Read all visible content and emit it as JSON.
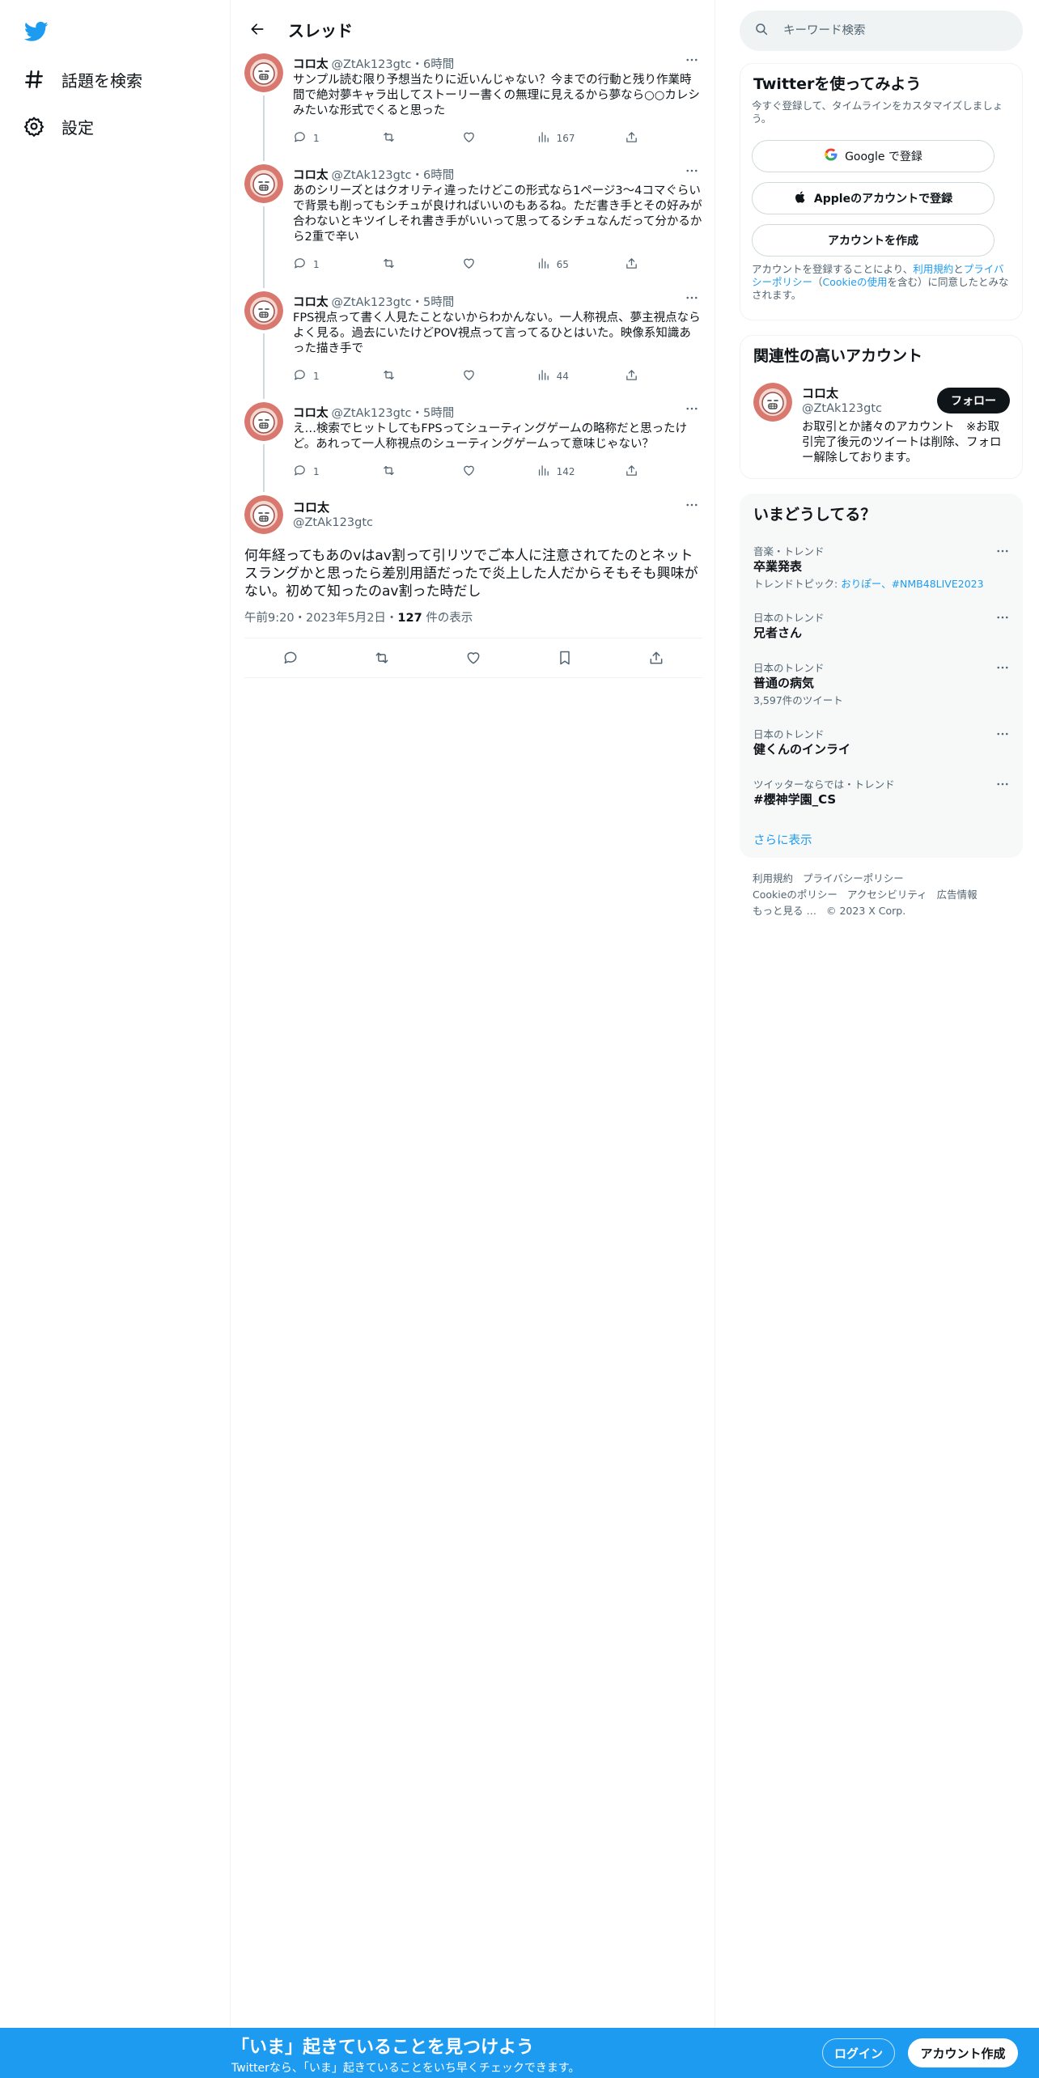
{
  "nav": {
    "items": [
      {
        "label": "話題を検索",
        "icon": "hashtag-icon"
      },
      {
        "label": "設定",
        "icon": "gear-icon"
      }
    ]
  },
  "header": {
    "title": "スレッド"
  },
  "thread": [
    {
      "name": "コロ太",
      "handle": "@ZtAk123gtc",
      "time": "・6時間",
      "text": "サンプル読む限り予想当たりに近いんじゃない？今までの行動と残り作業時間で絶対夢キャラ出してストーリー書くの無理に見えるから夢なら○○カレシみたいな形式でくると思った",
      "replies": "1",
      "retweets": "",
      "likes": "",
      "views": "167"
    },
    {
      "name": "コロ太",
      "handle": "@ZtAk123gtc",
      "time": "・6時間",
      "text": "あのシリーズとはクオリティ違ったけどこの形式なら1ページ3～4コマぐらいで背景も削ってもシチュが良ければいいのもあるね。ただ書き手とその好みが合わないとキツイしそれ書き手がいいって思ってるシチュなんだって分かるから2重で辛い",
      "replies": "1",
      "retweets": "",
      "likes": "",
      "views": "65"
    },
    {
      "name": "コロ太",
      "handle": "@ZtAk123gtc",
      "time": "・5時間",
      "text": "FPS視点って書く人見たことないからわかんない。一人称視点、夢主視点ならよく見る。過去にいたけどPOV視点って言ってるひとはいた。映像系知識あった描き手で",
      "replies": "1",
      "retweets": "",
      "likes": "",
      "views": "44"
    },
    {
      "name": "コロ太",
      "handle": "@ZtAk123gtc",
      "time": "・5時間",
      "text": "え…検索でヒットしてもFPSってシューティングゲームの略称だと思ったけど。あれって一人称視点のシューティングゲームって意味じゃない？",
      "replies": "1",
      "retweets": "",
      "likes": "",
      "views": "142"
    }
  ],
  "main_tweet": {
    "name": "コロ太",
    "handle": "@ZtAk123gtc",
    "text": "何年経ってもあのvはav割って引リツでご本人に注意されてたのとネットスラングかと思ったら差別用語だったで炎上した人だからそもそも興味がない。初めて知ったのav割った時だし",
    "time": "午前9:20・2023年5月2日・",
    "views": "127",
    "views_suffix": "件の表示"
  },
  "search": {
    "placeholder": "キーワード検索"
  },
  "signup": {
    "title": "Twitterを使ってみよう",
    "subtitle": "今すぐ登録して、タイムラインをカスタマイズしましょう。",
    "google": "Google で登録",
    "apple": "Appleのアカウントで登録",
    "create": "アカウントを作成",
    "legal_1": "アカウントを登録することにより、",
    "legal_terms": "利用規約",
    "legal_2": "と",
    "legal_privacy": "プライバシーポリシー",
    "legal_3": "（",
    "legal_cookie": "Cookieの使用",
    "legal_4": "を含む）に同意したとみなされます。"
  },
  "related": {
    "title": "関連性の高いアカウント",
    "name": "コロ太",
    "handle": "@ZtAk123gtc",
    "bio": "お取引とか諸々のアカウント　※お取引完了後元のツイートは削除、フォロー解除しております。",
    "follow": "フォロー"
  },
  "trends": {
    "title": "いまどうしてる？",
    "items": [
      {
        "context": "音楽・トレンド",
        "name": "卒業発表",
        "extra_prefix": "トレンドトピック: ",
        "extra_links": "おりぽー、#NMB48LIVE2023"
      },
      {
        "context": "日本のトレンド",
        "name": "兄者さん"
      },
      {
        "context": "日本のトレンド",
        "name": "普通の病気",
        "extra": "3,597件のツイート"
      },
      {
        "context": "日本のトレンド",
        "name": "健くんのインライ"
      },
      {
        "context": "ツイッターならでは・トレンド",
        "name": "#櫻神学園_CS"
      }
    ],
    "show_more": "さらに表示"
  },
  "footer": {
    "links": [
      "利用規約",
      "プライバシーポリシー",
      "Cookieのポリシー",
      "アクセシビリティ",
      "広告情報",
      "もっと見る …"
    ],
    "copyright": "© 2023 X Corp."
  },
  "bottom": {
    "headline": "「いま」起きていることを見つけよう",
    "sub": "Twitterなら、「いま」起きていることをいち早くチェックできます。",
    "login": "ログイン",
    "create": "アカウント作成"
  },
  "colors": {
    "accent": "#1d9bf0",
    "text": "#0f1419",
    "muted": "#536471",
    "border": "#eff3f4"
  }
}
